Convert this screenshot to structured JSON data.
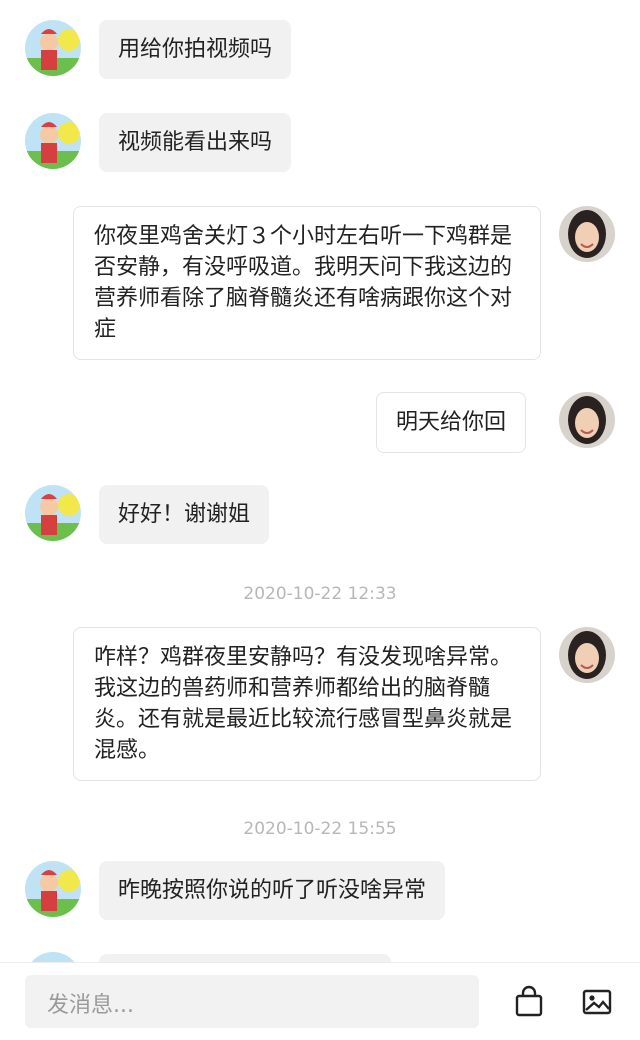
{
  "messages": [
    {
      "text": "用给你拍视频吗"
    },
    {
      "text": "视频能看出来吗"
    },
    {
      "text": "你夜里鸡舍关灯３个小时左右听一下鸡群是否安静，有没呼吸道。我明天问下我这边的营养师看除了脑脊髓炎还有啥病跟你这个对症"
    },
    {
      "text": "明天给你回"
    },
    {
      "text": "好好！谢谢姐"
    },
    {
      "timestamp": "2020-10-22 12:33"
    },
    {
      "text": "咋样？鸡群夜里安静吗？有没发现啥异常。我这边的兽药师和营养师都给出的脑脊髓炎。还有就是最近比较流行感冒型鼻炎就是混感。"
    },
    {
      "timestamp": "2020-10-22 15:55"
    },
    {
      "text": "昨晚按照你说的听了听没啥异常"
    }
  ],
  "composer": {
    "placeholder": "发消息..."
  },
  "icons": {
    "bag": "shopping-bag-icon",
    "image": "image-icon"
  },
  "colors": {
    "incoming_bubble": "#f1f1f1",
    "outgoing_bubble": "#ffffff"
  }
}
